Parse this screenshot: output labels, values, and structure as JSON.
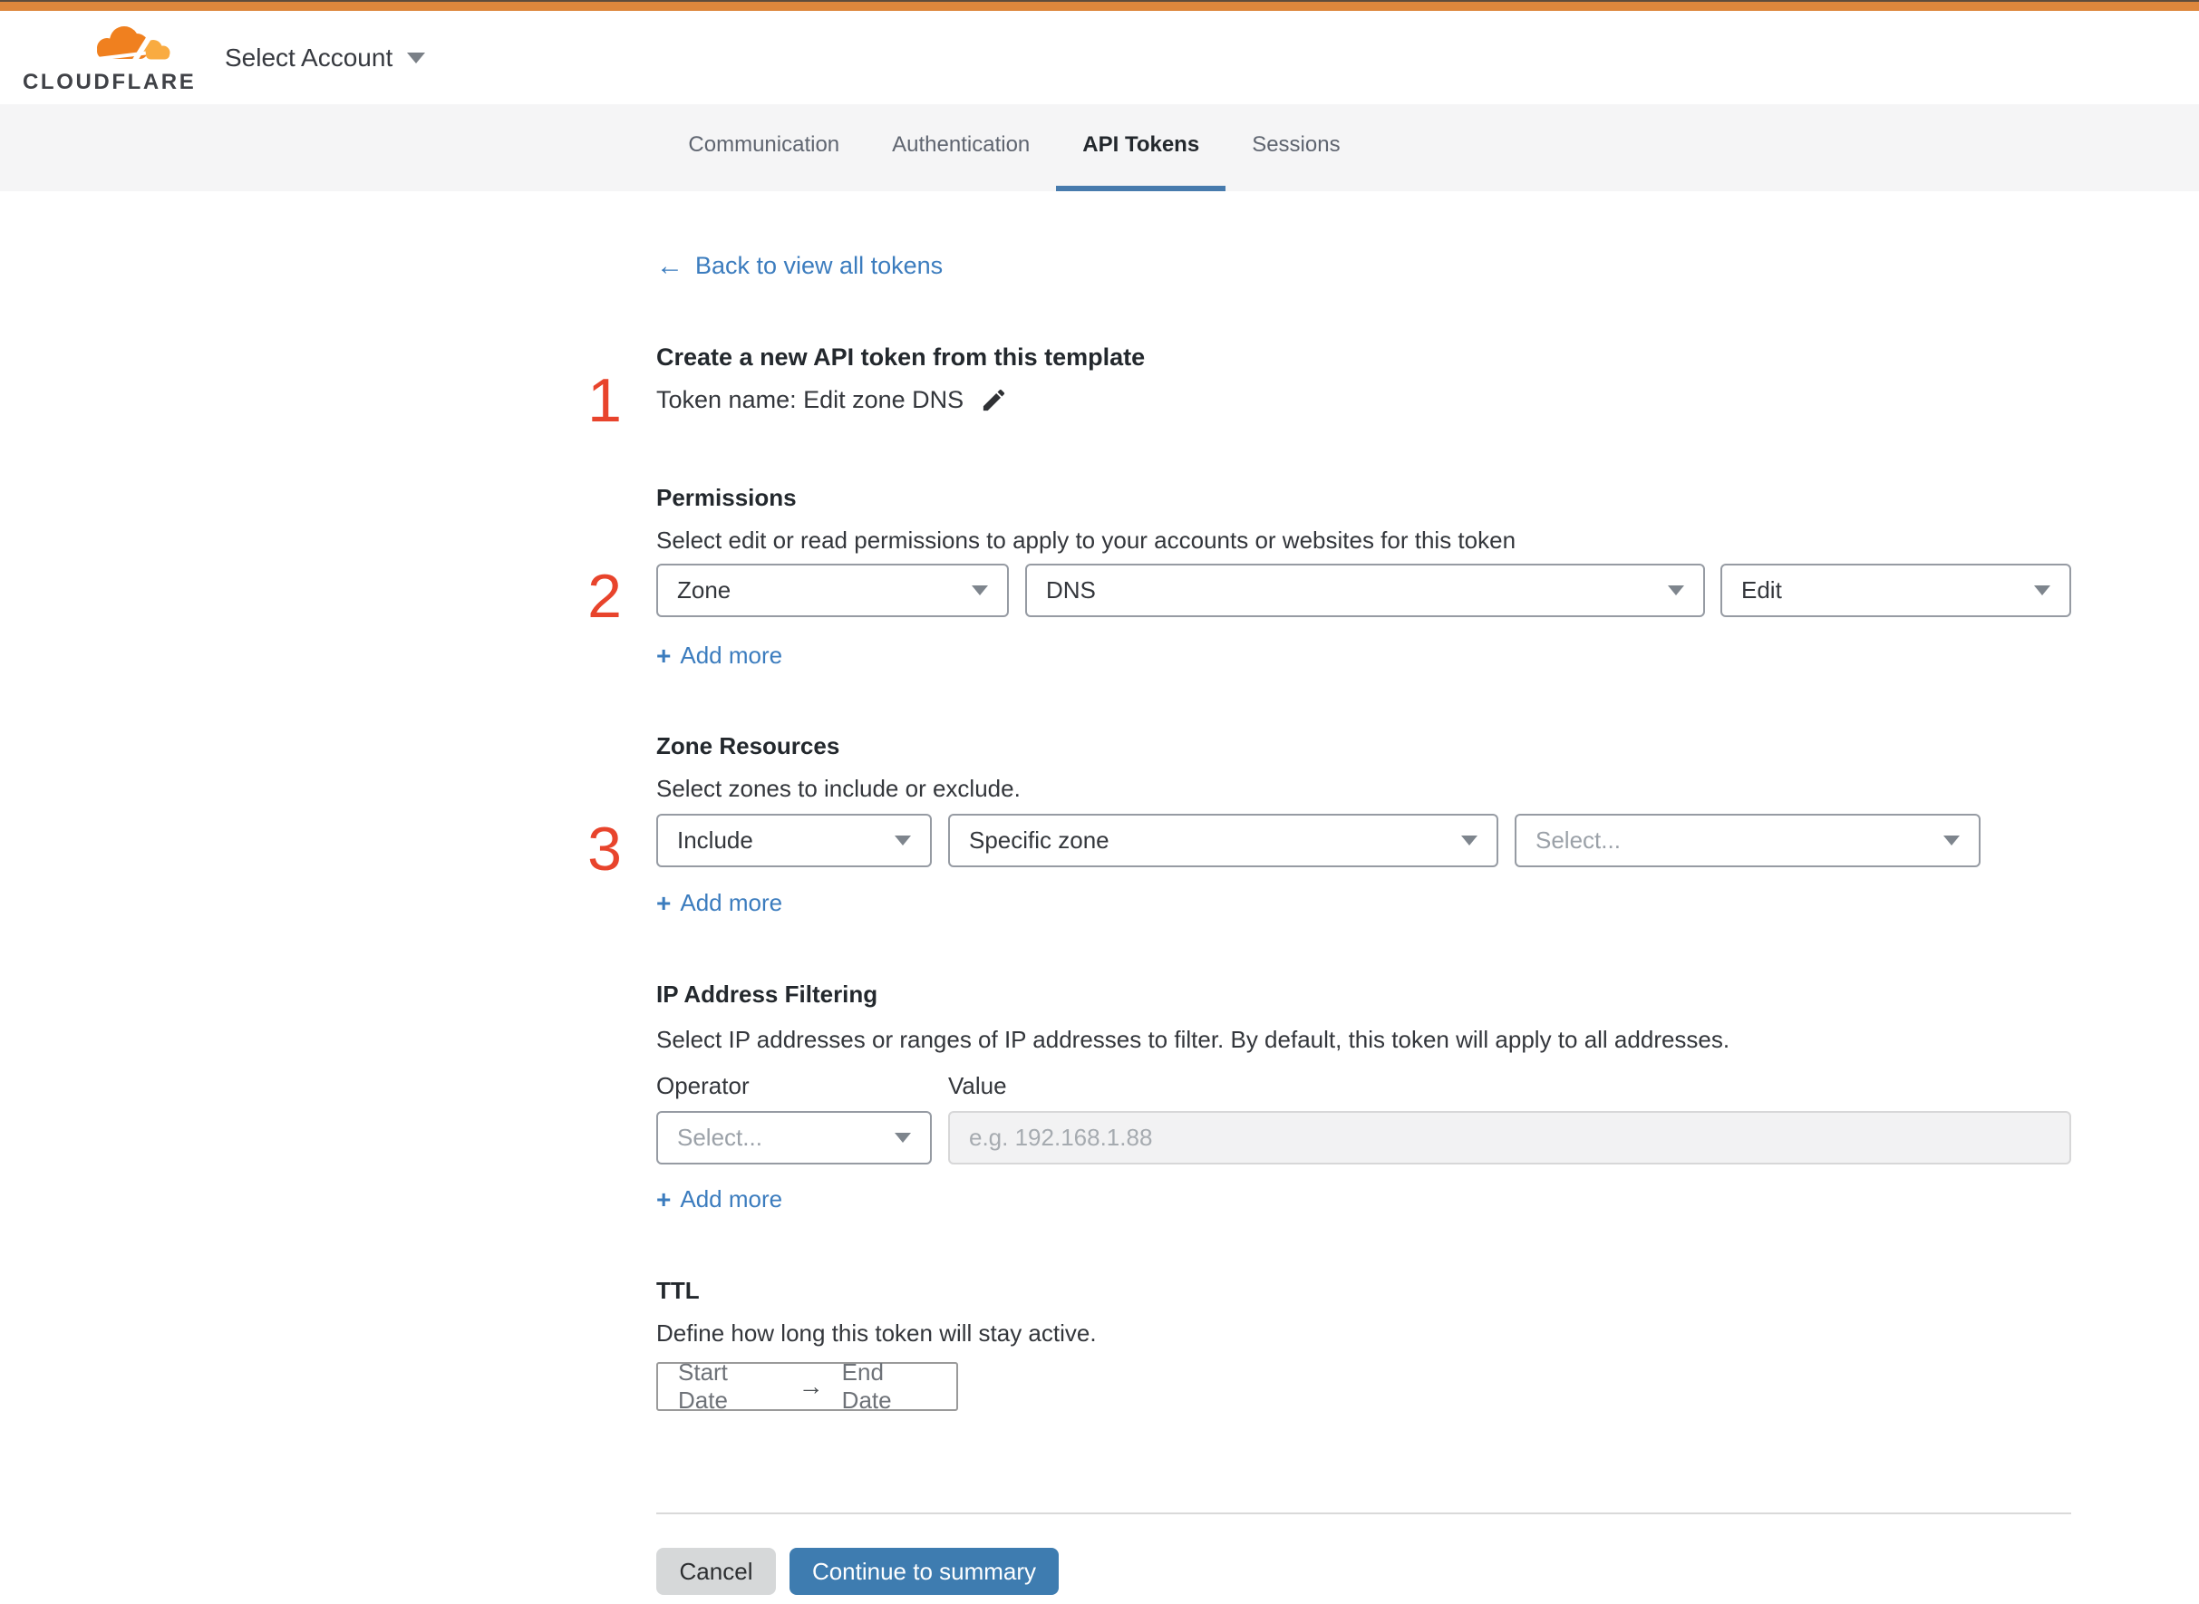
{
  "header": {
    "brand": "CLOUDFLARE",
    "account_selector": "Select Account"
  },
  "tabs": {
    "items": [
      {
        "label": "Communication"
      },
      {
        "label": "Authentication"
      },
      {
        "label": "API Tokens"
      },
      {
        "label": "Sessions"
      }
    ],
    "active": "API Tokens"
  },
  "back_link": {
    "arrow": "←",
    "label": "Back to view all tokens"
  },
  "token_section": {
    "step": "1",
    "heading": "Create a new API token from this template",
    "name_line": "Token name: Edit zone DNS"
  },
  "permissions": {
    "step": "2",
    "heading": "Permissions",
    "description": "Select edit or read permissions to apply to your accounts or websites for this token",
    "scope_value": "Zone",
    "resource_value": "DNS",
    "access_value": "Edit",
    "add_more": {
      "plus": "+",
      "label": "Add more"
    }
  },
  "zone_resources": {
    "step": "3",
    "heading": "Zone Resources",
    "description": "Select zones to include or exclude.",
    "mode_value": "Include",
    "type_value": "Specific zone",
    "zone_placeholder": "Select...",
    "add_more": {
      "plus": "+",
      "label": "Add more"
    }
  },
  "ip_filtering": {
    "heading": "IP Address Filtering",
    "description": "Select IP addresses or ranges of IP addresses to filter. By default, this token will apply to all addresses.",
    "operator_label": "Operator",
    "value_label": "Value",
    "operator_placeholder": "Select...",
    "value_placeholder": "e.g. 192.168.1.88",
    "add_more": {
      "plus": "+",
      "label": "Add more"
    }
  },
  "ttl": {
    "heading": "TTL",
    "description": "Define how long this token will stay active.",
    "start_label": "Start Date",
    "arrow": "→",
    "end_label": "End Date"
  },
  "footer": {
    "cancel_label": "Cancel",
    "continue_label": "Continue to summary"
  },
  "colors": {
    "topbar_orange": "#dd873c",
    "brand_orange": "#f0801f",
    "brand_orange_light": "#f9ab41",
    "link_blue": "#3b7cbe",
    "button_blue": "#3e7cb0",
    "step_number_red": "#e8442c",
    "tab_underline_blue": "#477bad",
    "tabbar_gray": "#f5f5f6"
  }
}
